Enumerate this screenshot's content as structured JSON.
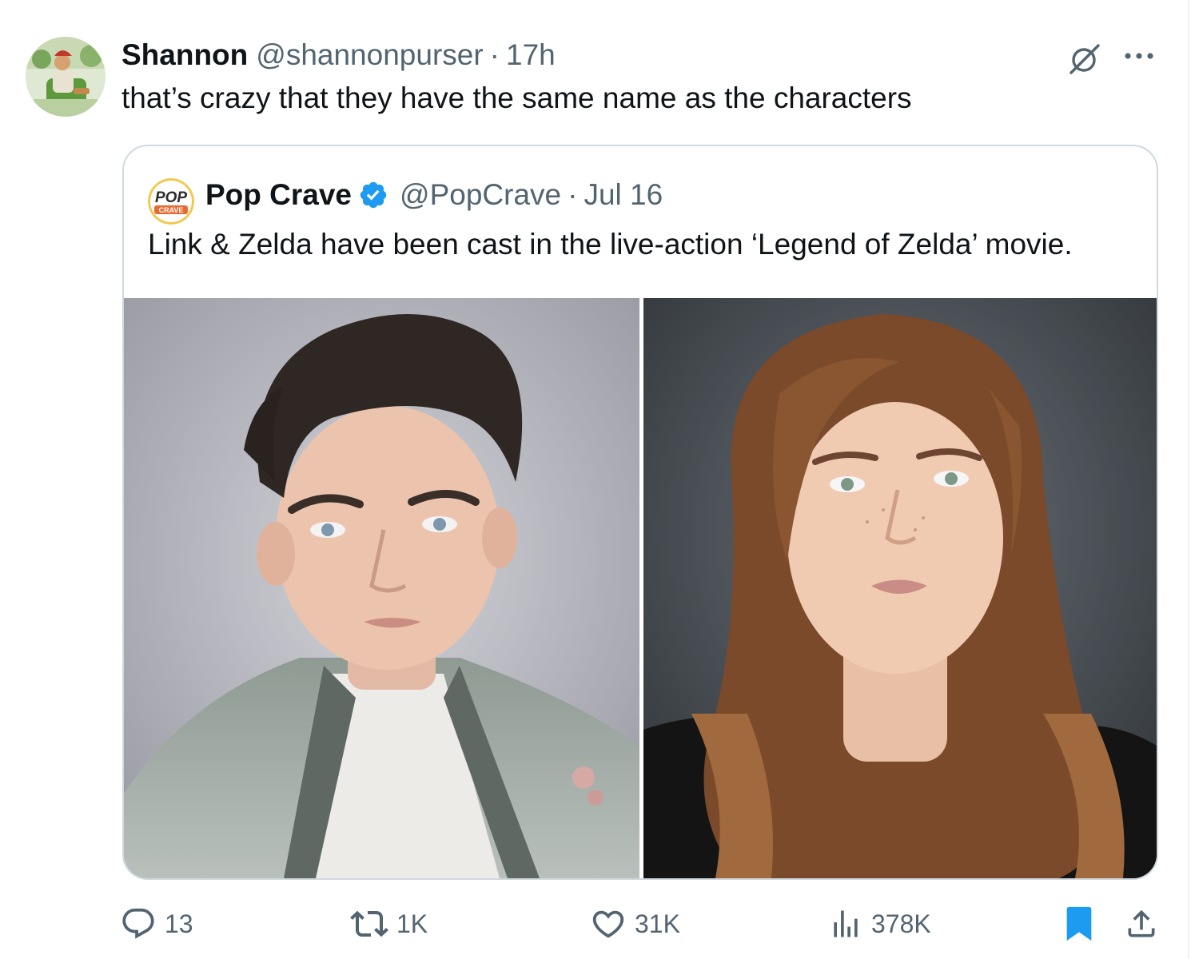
{
  "tweet": {
    "author_name": "Shannon",
    "author_handle": "@shannonpurser",
    "separator": "·",
    "time": "17h",
    "text": "that’s crazy that they have the same name as the characters"
  },
  "quote": {
    "author_name": "Pop Crave",
    "author_handle": "@PopCrave",
    "separator": "·",
    "date": "Jul 16",
    "text": "Link & Zelda have been cast in the live-action ‘Legend of Zelda’ movie.",
    "avatar_logo_text_top": "POP",
    "avatar_logo_text_bottom": "CRAVE"
  },
  "stats": {
    "replies": "13",
    "retweets": "1K",
    "likes": "31K",
    "views": "378K"
  },
  "colors": {
    "text_primary": "#0f1419",
    "text_secondary": "#536471",
    "accent_blue": "#1d9bf0",
    "border": "#cfd9de"
  },
  "icons": {
    "grok": "grok-icon",
    "more": "more-icon",
    "reply": "reply-icon",
    "retweet": "retweet-icon",
    "like": "like-icon",
    "views": "views-icon",
    "bookmark": "bookmark-icon",
    "share": "share-icon",
    "verified": "verified-badge-icon"
  }
}
